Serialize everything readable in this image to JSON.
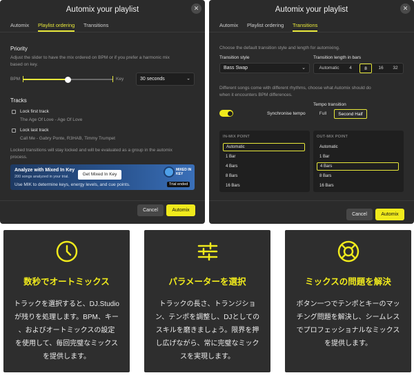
{
  "dialog1": {
    "title": "Automix your playlist",
    "tabs": [
      "Automix",
      "Playlist ordering",
      "Transitions"
    ],
    "active_tab": "Playlist ordering",
    "priority": {
      "heading": "Priority",
      "description_line1": "Adjust the slider to have the mix ordered on BPM or if you prefer a harmonic mix",
      "description_line2": "based on key.",
      "left_label": "BPM",
      "right_label": "Key",
      "slider_position": 0.5,
      "duration_select": "30 seconds"
    },
    "tracks": {
      "heading": "Tracks",
      "items": [
        {
          "label": "Lock first track",
          "subtitle": "The Age Of Love - Age Of Love"
        },
        {
          "label": "Lock last track",
          "subtitle": "Call Me - Gabry Ponte, R3HAB, Timmy Trumpet"
        }
      ],
      "note_line1": "Locked transitions will stay locked and will be evaluated as a group in the automix",
      "note_line2": "process."
    },
    "promo": {
      "title": "Analyze with Mixed In Key",
      "subtitle": "200 songs analyzed in your trial.",
      "button": "Get Mixed In Key",
      "body": "Use MIK to determine keys, energy levels, and cue points.",
      "logo_text": "MIXED IN KEY",
      "badge": "Trial ended"
    },
    "footer": {
      "cancel": "Cancel",
      "primary": "Automix"
    }
  },
  "dialog2": {
    "title": "Automix your playlist",
    "tabs": [
      "Automix",
      "Playlist ordering",
      "Transitions"
    ],
    "active_tab": "Transitions",
    "intro": "Choose the default transition style and length for automixing.",
    "style_label": "Transition style",
    "style_value": "Bass Swap",
    "length_label": "Transition length in bars",
    "length_options": [
      "Automatic",
      "4",
      "8",
      "16",
      "32"
    ],
    "length_selected": "8",
    "bpm_note_line1": "Different songs come with different rhythms, choose what Automix should do",
    "bpm_note_line2": "when it encounters BPM differences.",
    "sync_label": "Synchronise tempo",
    "sync_on": true,
    "tempo_label": "Tempo transition",
    "tempo_options": [
      "Full",
      "Second Half"
    ],
    "tempo_selected": "Second Half",
    "in_mix": {
      "heading": "IN-MIX POINT",
      "options": [
        "Automatic",
        "1 Bar",
        "4 Bars",
        "8 Bars",
        "16 Bars"
      ],
      "selected": "Automatic"
    },
    "out_mix": {
      "heading": "OUT-MIX POINT",
      "options": [
        "Automatic",
        "1 Bar",
        "4 Bars",
        "8 Bars",
        "16 Bars"
      ],
      "selected": "4 Bars"
    },
    "footer": {
      "cancel": "Cancel",
      "primary": "Automix"
    }
  },
  "features": [
    {
      "icon": "clock-icon",
      "title": "数秒でオートミックス",
      "lines": [
        "トラックを選択すると、DJ.Studio",
        "が残りを処理します。BPM、キー",
        "、およびオートミックスの設定",
        "を使用して、毎回完璧なミックス",
        "を提供します。"
      ]
    },
    {
      "icon": "sliders-icon",
      "title": "パラメーターを選択",
      "lines": [
        "トラックの長さ、トランジショ",
        "ン、テンポを調整し、DJとしての",
        "スキルを磨きましょう。限界を押",
        "し広げながら、常に完璧なミック",
        "スを実現します。"
      ]
    },
    {
      "icon": "lifebuoy-icon",
      "title": "ミックスの問題を解決",
      "lines": [
        "ボタン一つでテンポとキーのマッ",
        "チング問題を解決し、シームレス",
        "でプロフェッショナルなミックス",
        "を提供します。"
      ]
    }
  ],
  "colors": {
    "accent": "#f0ea1c",
    "dialog_bg": "#2b2b2b",
    "card_bg": "#2e2e2e"
  }
}
